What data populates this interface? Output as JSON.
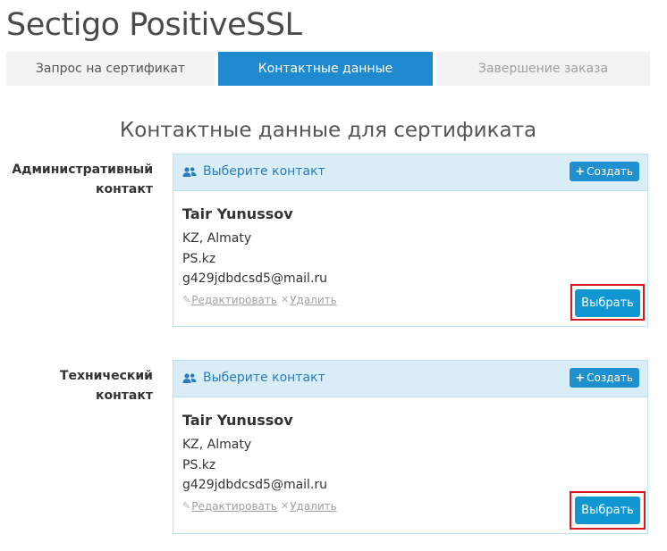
{
  "page": {
    "title": "Sectigo PositiveSSL"
  },
  "steps": [
    {
      "label": "Запрос на сертификат"
    },
    {
      "label": "Контактные данные"
    },
    {
      "label": "Завершение заказа"
    }
  ],
  "section": {
    "title": "Контактные данные для сертификата"
  },
  "contacts": [
    {
      "label_line1": "Административный",
      "label_line2": "контакт",
      "header_text": "Выберите контакт",
      "create_label": "Создать",
      "name": "Tair Yunussov",
      "location": "KZ, Almaty",
      "company": "PS.kz",
      "email": "g429jdbdcsd5@mail.ru",
      "edit_label": "Редактировать",
      "delete_label": "Удалить",
      "select_label": "Выбрать"
    },
    {
      "label_line1": "Технический контакт",
      "label_line2": "",
      "header_text": "Выберите контакт",
      "create_label": "Создать",
      "name": "Tair Yunussov",
      "location": "KZ, Almaty",
      "company": "PS.kz",
      "email": "g429jdbdcsd5@mail.ru",
      "edit_label": "Редактировать",
      "delete_label": "Удалить",
      "select_label": "Выбрать"
    }
  ],
  "icons": {
    "users": "users-icon",
    "plus": "plus-icon",
    "pencil": "pencil-icon",
    "delete": "times-icon"
  },
  "colors": {
    "active_step": "#1f8ad0",
    "panel_header": "#d9edf7",
    "button": "#1096d0",
    "highlight": "#d9181f"
  }
}
